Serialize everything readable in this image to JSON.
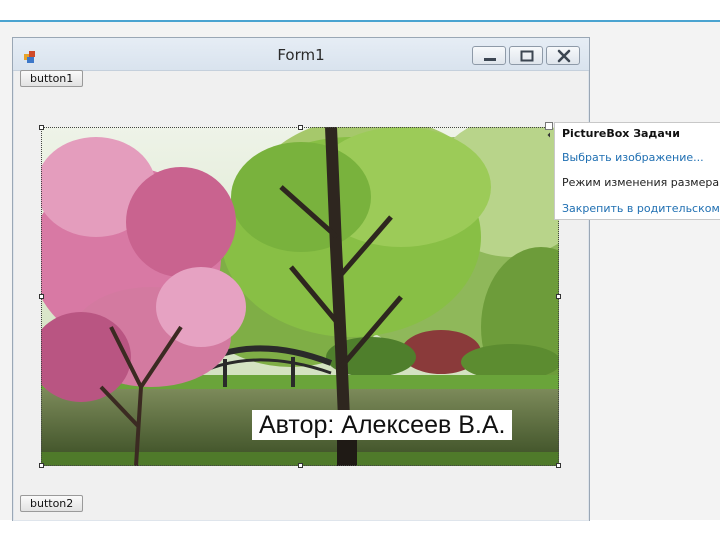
{
  "form": {
    "title": "Form1",
    "button1_label": "button1",
    "button2_label": "button2"
  },
  "picture": {
    "caption": "Автор: Алексеев В.А."
  },
  "tasks_panel": {
    "title": "PictureBox Задачи",
    "items": [
      {
        "label": "Выбрать изображение...",
        "type": "link"
      },
      {
        "label": "Режим изменения размера",
        "type": "text"
      },
      {
        "label": "Закрепить в родительском",
        "type": "link"
      }
    ]
  },
  "colors": {
    "accent_line": "#4aa3d0",
    "link": "#1f6fb2"
  }
}
